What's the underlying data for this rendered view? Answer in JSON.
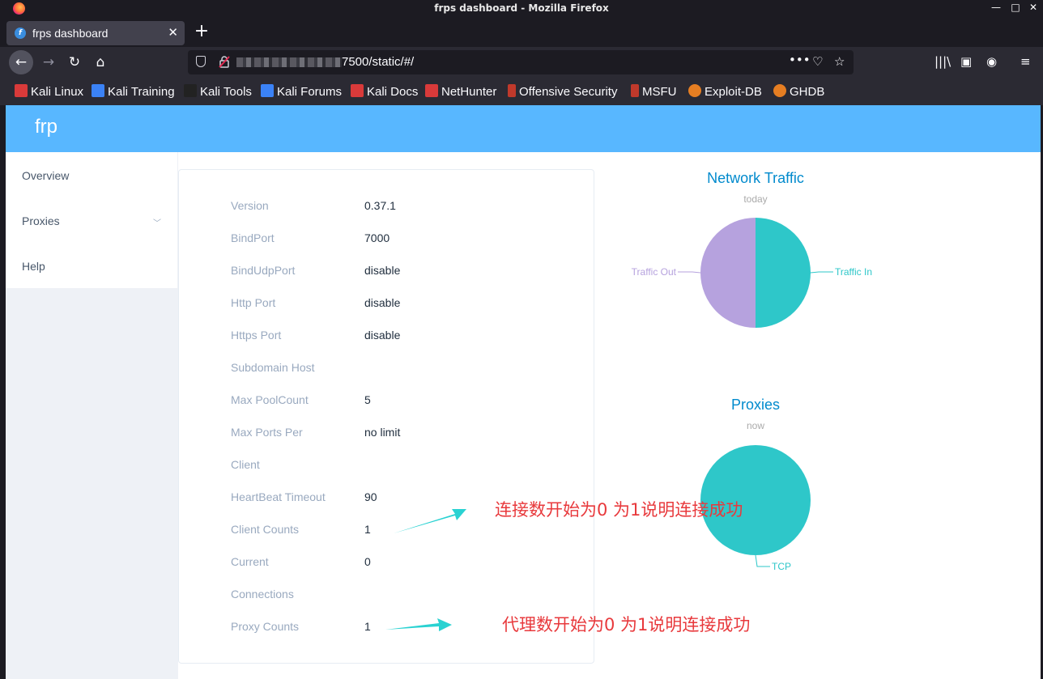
{
  "window": {
    "title": "frps dashboard - Mozilla Firefox",
    "controls": [
      "—",
      "□",
      "✕"
    ]
  },
  "tab": {
    "title": "frps dashboard"
  },
  "urlbar": {
    "url": "7500/static/#/"
  },
  "bookmarks": [
    {
      "label": "Kali Linux",
      "color": "#d93a3a"
    },
    {
      "label": "Kali Training",
      "color": "#3b82f6"
    },
    {
      "label": "Kali Tools",
      "color": "#222222"
    },
    {
      "label": "Kali Forums",
      "color": "#3b82f6"
    },
    {
      "label": "Kali Docs",
      "color": "#d93a3a"
    },
    {
      "label": "NetHunter",
      "color": "#d93a3a"
    },
    {
      "label": "Offensive Security",
      "color": "#c0392b"
    },
    {
      "label": "MSFU",
      "color": "#c0392b"
    },
    {
      "label": "Exploit-DB",
      "color": "#e67e22"
    },
    {
      "label": "GHDB",
      "color": "#e67e22"
    }
  ],
  "app": {
    "brand": "frp",
    "header_color": "#58b7ff"
  },
  "menu": {
    "overview": "Overview",
    "proxies": "Proxies",
    "help": "Help"
  },
  "server_info": [
    {
      "label": "Version",
      "value": "0.37.1"
    },
    {
      "label": "BindPort",
      "value": "7000"
    },
    {
      "label": "BindUdpPort",
      "value": "disable"
    },
    {
      "label": "Http Port",
      "value": "disable"
    },
    {
      "label": "Https Port",
      "value": "disable"
    },
    {
      "label": "Subdomain Host",
      "value": ""
    },
    {
      "label": "Max PoolCount",
      "value": "5"
    },
    {
      "label": "Max Ports Per",
      "value": "no limit"
    },
    {
      "label": "Client",
      "value": ""
    },
    {
      "label": "HeartBeat Timeout",
      "value": "90"
    },
    {
      "label": "Client Counts",
      "value": "1"
    },
    {
      "label": "Current",
      "value": "0"
    },
    {
      "label": "Connections",
      "value": ""
    },
    {
      "label": "Proxy Counts",
      "value": "1"
    }
  ],
  "chart_data": [
    {
      "type": "pie",
      "title": "Network Traffic",
      "subtitle": "today",
      "slices": [
        {
          "name": "Traffic In",
          "value": 50,
          "color": "#2ec7c9"
        },
        {
          "name": "Traffic Out",
          "value": 50,
          "color": "#b6a2de"
        }
      ]
    },
    {
      "type": "pie",
      "title": "Proxies",
      "subtitle": "now",
      "slices": [
        {
          "name": "TCP",
          "value": 1,
          "color": "#2ec7c9"
        }
      ]
    }
  ],
  "annotations": {
    "client_note": "连接数开始为0 为1说明连接成功",
    "proxy_note": "代理数开始为0 为1说明连接成功",
    "arrow_color": "#2ad2d2"
  }
}
